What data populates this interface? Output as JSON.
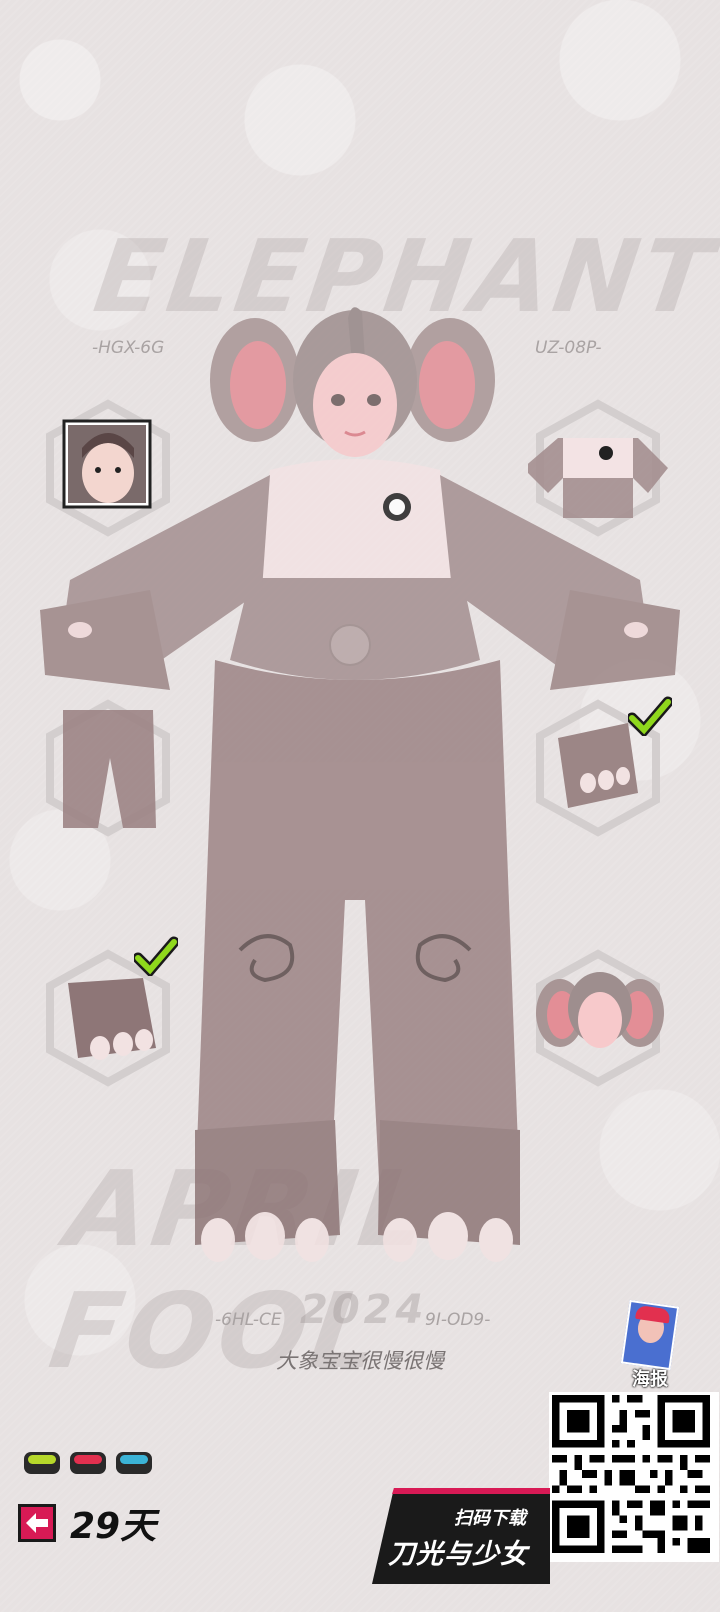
{
  "background": {
    "top_word": "ELEPHANT",
    "bottom_word": "APRIL FOOL",
    "year": "2024"
  },
  "codes": {
    "top_left": "-HGX-6G",
    "top_right": "UZ-08P-",
    "bottom_left": "-6HL-CE",
    "bottom_right": "9I-OD9-"
  },
  "outfit_slots": [
    {
      "name": "face",
      "checked": false
    },
    {
      "name": "top",
      "checked": false
    },
    {
      "name": "pants",
      "checked": false
    },
    {
      "name": "gloves",
      "checked": true
    },
    {
      "name": "shoes",
      "checked": true
    },
    {
      "name": "hat",
      "checked": false
    }
  ],
  "caption": "大象宝宝很慢很慢",
  "indicator_colors": [
    "#b6d82a",
    "#e2304f",
    "#3bb3d6"
  ],
  "days_left": "29天",
  "poster": {
    "label": "海报"
  },
  "promo": {
    "line1": "扫码下载",
    "line2": "刀光与少女"
  },
  "colors": {
    "accent": "#d81a55",
    "check": "#8fd81c"
  }
}
